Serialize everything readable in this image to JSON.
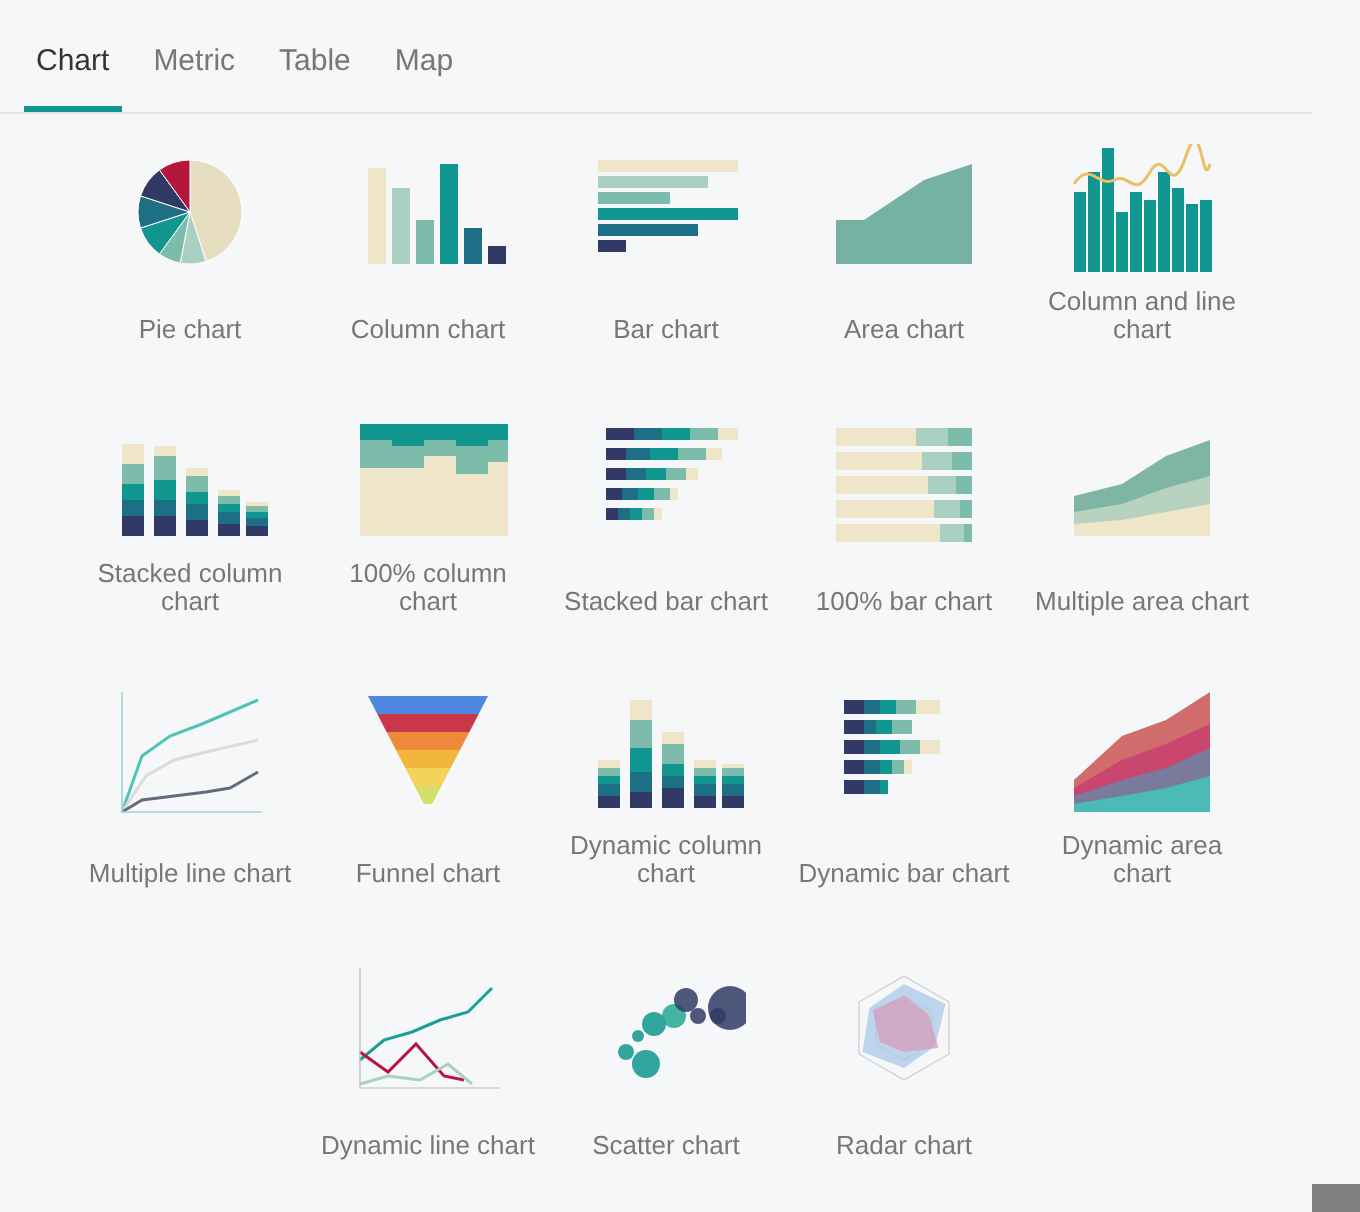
{
  "tabs": [
    {
      "label": "Chart",
      "selected": true
    },
    {
      "label": "Metric",
      "selected": false
    },
    {
      "label": "Table",
      "selected": false
    },
    {
      "label": "Map",
      "selected": false
    }
  ],
  "charts": [
    {
      "label": "Pie chart",
      "kind": "pie"
    },
    {
      "label": "Column chart",
      "kind": "column"
    },
    {
      "label": "Bar chart",
      "kind": "bar"
    },
    {
      "label": "Area chart",
      "kind": "area"
    },
    {
      "label": "Column and line chart",
      "kind": "columnline"
    },
    {
      "label": "Stacked column chart",
      "kind": "stackedcolumn"
    },
    {
      "label": "100% column chart",
      "kind": "fullcolumn"
    },
    {
      "label": "Stacked bar chart",
      "kind": "stackedbar"
    },
    {
      "label": "100% bar chart",
      "kind": "fullbar"
    },
    {
      "label": "Multiple area chart",
      "kind": "multiarea"
    },
    {
      "label": "Multiple line chart",
      "kind": "multiline"
    },
    {
      "label": "Funnel chart",
      "kind": "funnel"
    },
    {
      "label": "Dynamic column chart",
      "kind": "dyncolumn"
    },
    {
      "label": "Dynamic bar chart",
      "kind": "dynbar"
    },
    {
      "label": "Dynamic area chart",
      "kind": "dynarea"
    },
    {
      "label": "Dynamic line chart",
      "kind": "dynline"
    },
    {
      "label": "Scatter chart",
      "kind": "scatter"
    },
    {
      "label": "Radar chart",
      "kind": "radar"
    }
  ]
}
